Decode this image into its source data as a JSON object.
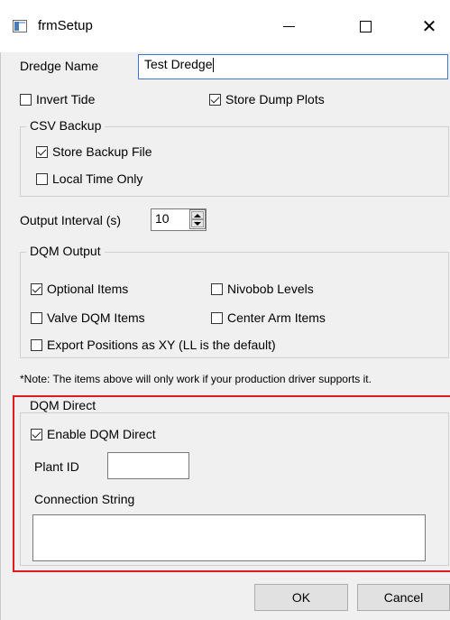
{
  "window": {
    "title": "frmSetup",
    "minimize_label": "—",
    "close_label": "✕"
  },
  "dredge_name": {
    "label": "Dredge Name",
    "value": "Test Dredge"
  },
  "invert_tide": {
    "label": "Invert Tide",
    "checked": false
  },
  "store_dump_plots": {
    "label": "Store Dump Plots",
    "checked": true
  },
  "csv_backup": {
    "title": "CSV Backup",
    "store_backup_file": {
      "label": "Store Backup File",
      "checked": true
    },
    "local_time_only": {
      "label": "Local Time Only",
      "checked": false
    }
  },
  "output_interval": {
    "label": "Output Interval (s)",
    "value": "10"
  },
  "dqm_output": {
    "title": "DQM Output",
    "optional_items": {
      "label": "Optional Items",
      "checked": true
    },
    "nivobob_levels": {
      "label": "Nivobob Levels",
      "checked": false
    },
    "valve_dqm_items": {
      "label": "Valve DQM Items",
      "checked": false
    },
    "center_arm_items": {
      "label": "Center Arm Items",
      "checked": false
    },
    "export_positions_xy": {
      "label": "Export Positions as XY (LL is the default)",
      "checked": false
    }
  },
  "note": "*Note: The items above will only work if your production driver supports it.",
  "dqm_direct": {
    "title": "DQM Direct",
    "enable": {
      "label": "Enable DQM Direct",
      "checked": true
    },
    "plant_id": {
      "label": "Plant ID",
      "value": ""
    },
    "connection_string": {
      "label": "Connection String",
      "value": ""
    }
  },
  "buttons": {
    "ok": "OK",
    "cancel": "Cancel"
  },
  "colors": {
    "highlight": "#e01b1b",
    "app_icon": "#4a7ab7"
  },
  "icons": [
    "app-icon",
    "minimize-icon",
    "maximize-icon",
    "close-icon",
    "checkmark-icon",
    "spin-up-icon",
    "spin-down-icon"
  ]
}
